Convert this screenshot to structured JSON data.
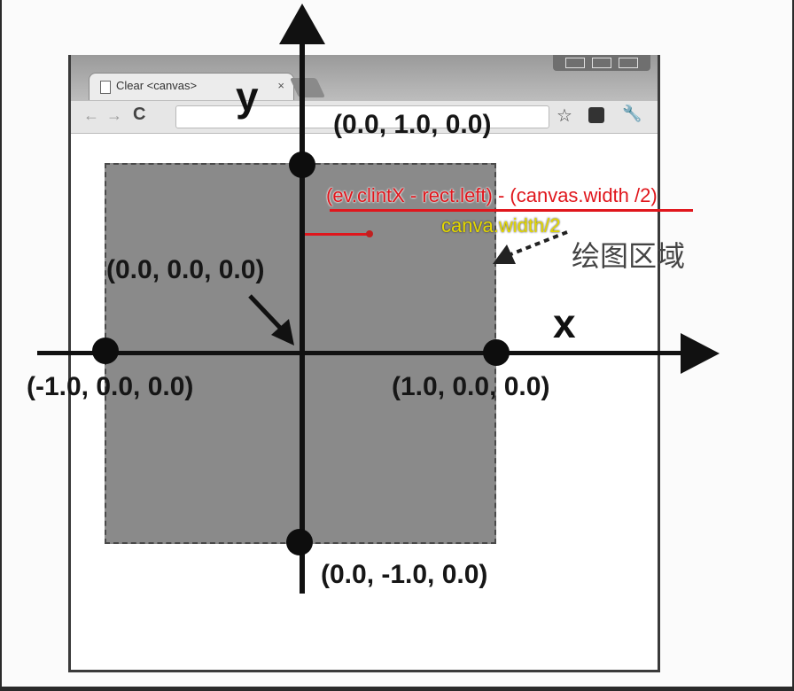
{
  "browser": {
    "tab_title": "Clear <canvas>",
    "tab_close": "×",
    "back_icon": "←",
    "forward_icon": "→",
    "reload_icon": "C",
    "star_icon": "☆",
    "wrench_icon": "🔧"
  },
  "diagram": {
    "axis_x": "x",
    "axis_y": "y",
    "point_top": "(0.0, 1.0, 0.0)",
    "point_origin": "(0.0, 0.0, 0.0)",
    "point_left": "(-1.0, 0.0, 0.0)",
    "point_right": "(1.0, 0.0, 0.0)",
    "point_bottom": "(0.0, -1.0, 0.0)",
    "drawing_area_label": "绘图区域"
  },
  "annotations": {
    "formula": "(ev.clintX - rect.left) - (canvas.width /2)",
    "half_width": "canva.width/2",
    "formula_color": "#e0161c",
    "half_width_color": "#e4d800"
  }
}
